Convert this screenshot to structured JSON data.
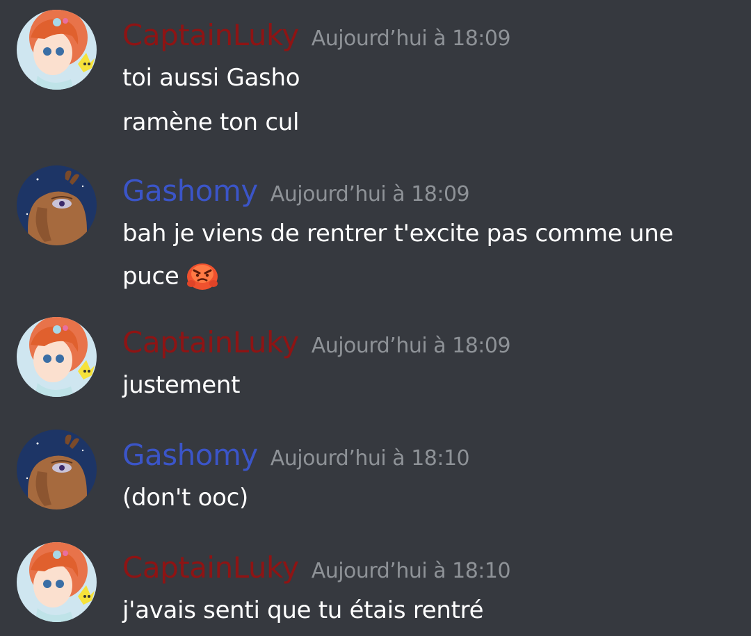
{
  "messages": [
    {
      "author": "CaptainLuky",
      "timestamp": "Aujourd’hui à 18:09",
      "lines": [
        "toi aussi Gasho",
        "ramène ton cul"
      ]
    },
    {
      "author": "Gashomy",
      "timestamp": "Aujourd’hui à 18:09",
      "lines": [
        "bah je viens de rentrer t'excite pas comme une",
        "puce"
      ],
      "emoji": "angry-face-emoji"
    },
    {
      "author": "CaptainLuky",
      "timestamp": "Aujourd’hui à 18:09",
      "lines": [
        "justement"
      ]
    },
    {
      "author": "Gashomy",
      "timestamp": "Aujourd’hui à 18:10",
      "lines": [
        "(don't ooc)"
      ]
    },
    {
      "author": "CaptainLuky",
      "timestamp": "Aujourd’hui à 18:10",
      "lines": [
        "j'avais senti que tu étais rentré"
      ]
    }
  ],
  "colors": {
    "background": "#36393f",
    "captainluky_name": "#8e1414",
    "gashomy_name": "#3b55c8",
    "timestamp": "#8e9297",
    "text": "#ffffff"
  }
}
